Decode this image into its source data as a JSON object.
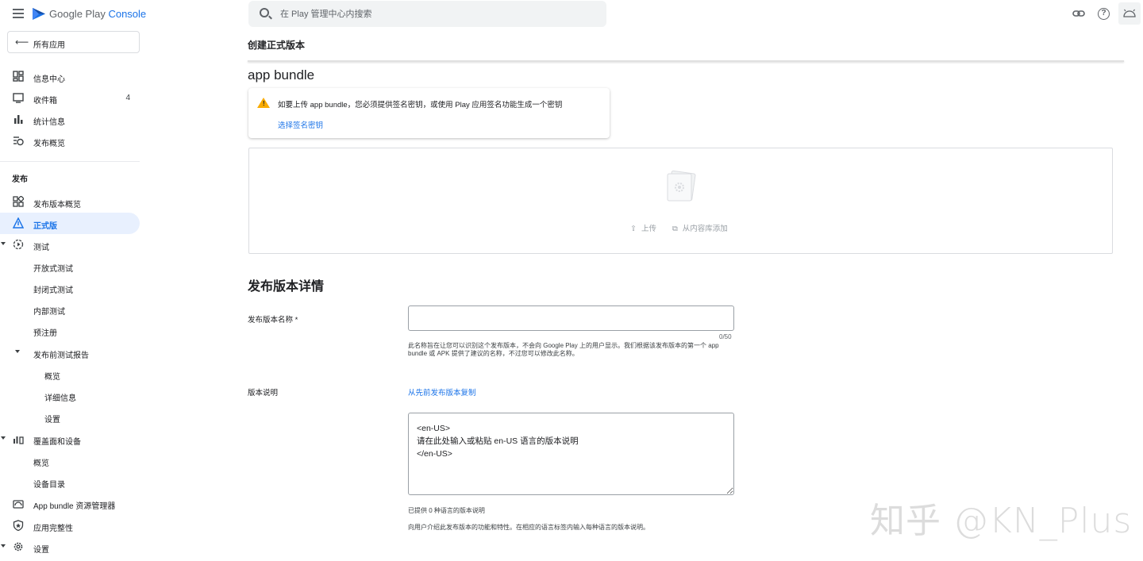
{
  "app": {
    "logo_main": "Google Play",
    "logo_sub": "Console"
  },
  "sidebar": {
    "all_apps": "所有应用",
    "items": [
      {
        "label": "信息中心"
      },
      {
        "label": "收件箱",
        "count": "4"
      },
      {
        "label": "统计信息"
      },
      {
        "label": "发布概览"
      }
    ],
    "section_release": "发布",
    "release_items": [
      {
        "label": "发布版本概览"
      },
      {
        "label": "正式版"
      },
      {
        "label": "测试"
      },
      {
        "label": "开放式测试"
      },
      {
        "label": "封闭式测试"
      },
      {
        "label": "内部测试"
      },
      {
        "label": "预注册"
      },
      {
        "label": "发布前测试报告"
      },
      {
        "label": "概览"
      },
      {
        "label": "详细信息"
      },
      {
        "label": "设置"
      },
      {
        "label": "覆盖面和设备"
      },
      {
        "label": "概览"
      },
      {
        "label": "设备目录"
      },
      {
        "label": "App bundle 资源管理器"
      },
      {
        "label": "应用完整性"
      },
      {
        "label": "设置"
      }
    ]
  },
  "search": {
    "placeholder": "在 Play 管理中心内搜索"
  },
  "main": {
    "page_title": "创建正式版本",
    "bundle_title": "app bundle",
    "warning_text": "如要上传 app bundle，您必须提供签名密钥，或使用 Play 应用签名功能生成一个密钥",
    "warning_link": "选择签名密钥",
    "upload_label": "上传",
    "library_label": "从内容库添加",
    "details_title": "发布版本详情",
    "release_name_label": "发布版本名称 *",
    "release_name_value": "",
    "release_name_counter": "0/50",
    "release_name_help": "此名称旨在让您可以识别这个发布版本，不会向 Google Play 上的用户显示。我们根据该发布版本的第一个 app bundle 或 APK 提供了建议的名称，不过您可以修改此名称。",
    "notes_label": "版本说明",
    "copy_link": "从先前发布版本复制",
    "notes_value": "<en-US>\n请在此处输入或粘贴 en-US 语言的版本说明\n</en-US>",
    "languages_note": "已提供 0 种语言的版本说明",
    "notes_help": "向用户介绍此发布版本的功能和特性。在相应的语言标签内输入每种语言的版本说明。"
  },
  "watermark": "知乎 @KN_Plus",
  "colors": {
    "accent": "#1a73e8",
    "warning": "#f9ab00",
    "active_bg": "#e8f0fe"
  }
}
